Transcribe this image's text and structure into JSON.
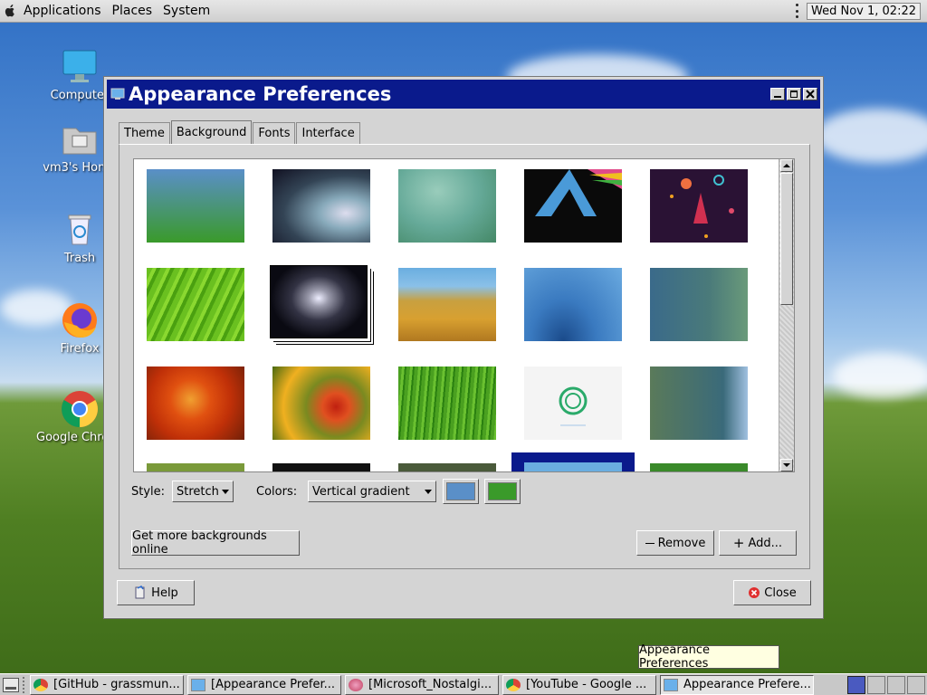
{
  "top_panel": {
    "menus": [
      "Applications",
      "Places",
      "System"
    ],
    "clock": "Wed Nov  1, 02:22"
  },
  "desktop_icons": [
    {
      "label": "Computer",
      "icon": "computer-icon"
    },
    {
      "label": "vm3's Home",
      "icon": "home-folder-icon"
    },
    {
      "label": "Trash",
      "icon": "trash-icon"
    },
    {
      "label": "Firefox",
      "icon": "firefox-icon"
    },
    {
      "label": "Google Chrome",
      "icon": "chrome-icon"
    }
  ],
  "window": {
    "title": "Appearance Preferences",
    "tabs": [
      "Theme",
      "Background",
      "Fonts",
      "Interface"
    ],
    "active_tab": "Background",
    "style_label": "Style:",
    "style_value": "Stretch",
    "colors_label": "Colors:",
    "colors_value": "Vertical gradient",
    "primary_color": "#5a8fc8",
    "secondary_color": "#3a9a2a",
    "get_more_label": "Get more backgrounds online",
    "remove_label": "Remove",
    "add_label": "Add...",
    "help_label": "Help",
    "close_label": "Close"
  },
  "tooltip": "Appearance Preferences",
  "taskbar": {
    "tasks": [
      {
        "label": "[GitHub - grassmun...",
        "icon": "chrome-icon",
        "active": false
      },
      {
        "label": "[Appearance Prefer...",
        "icon": "appearance-icon",
        "active": false
      },
      {
        "label": "[Microsoft_Nostalgi...",
        "icon": "app-icon",
        "active": false
      },
      {
        "label": "[YouTube - Google ...",
        "icon": "chrome-icon",
        "active": false
      },
      {
        "label": "Appearance Prefere...",
        "icon": "appearance-icon",
        "active": true
      }
    ]
  }
}
